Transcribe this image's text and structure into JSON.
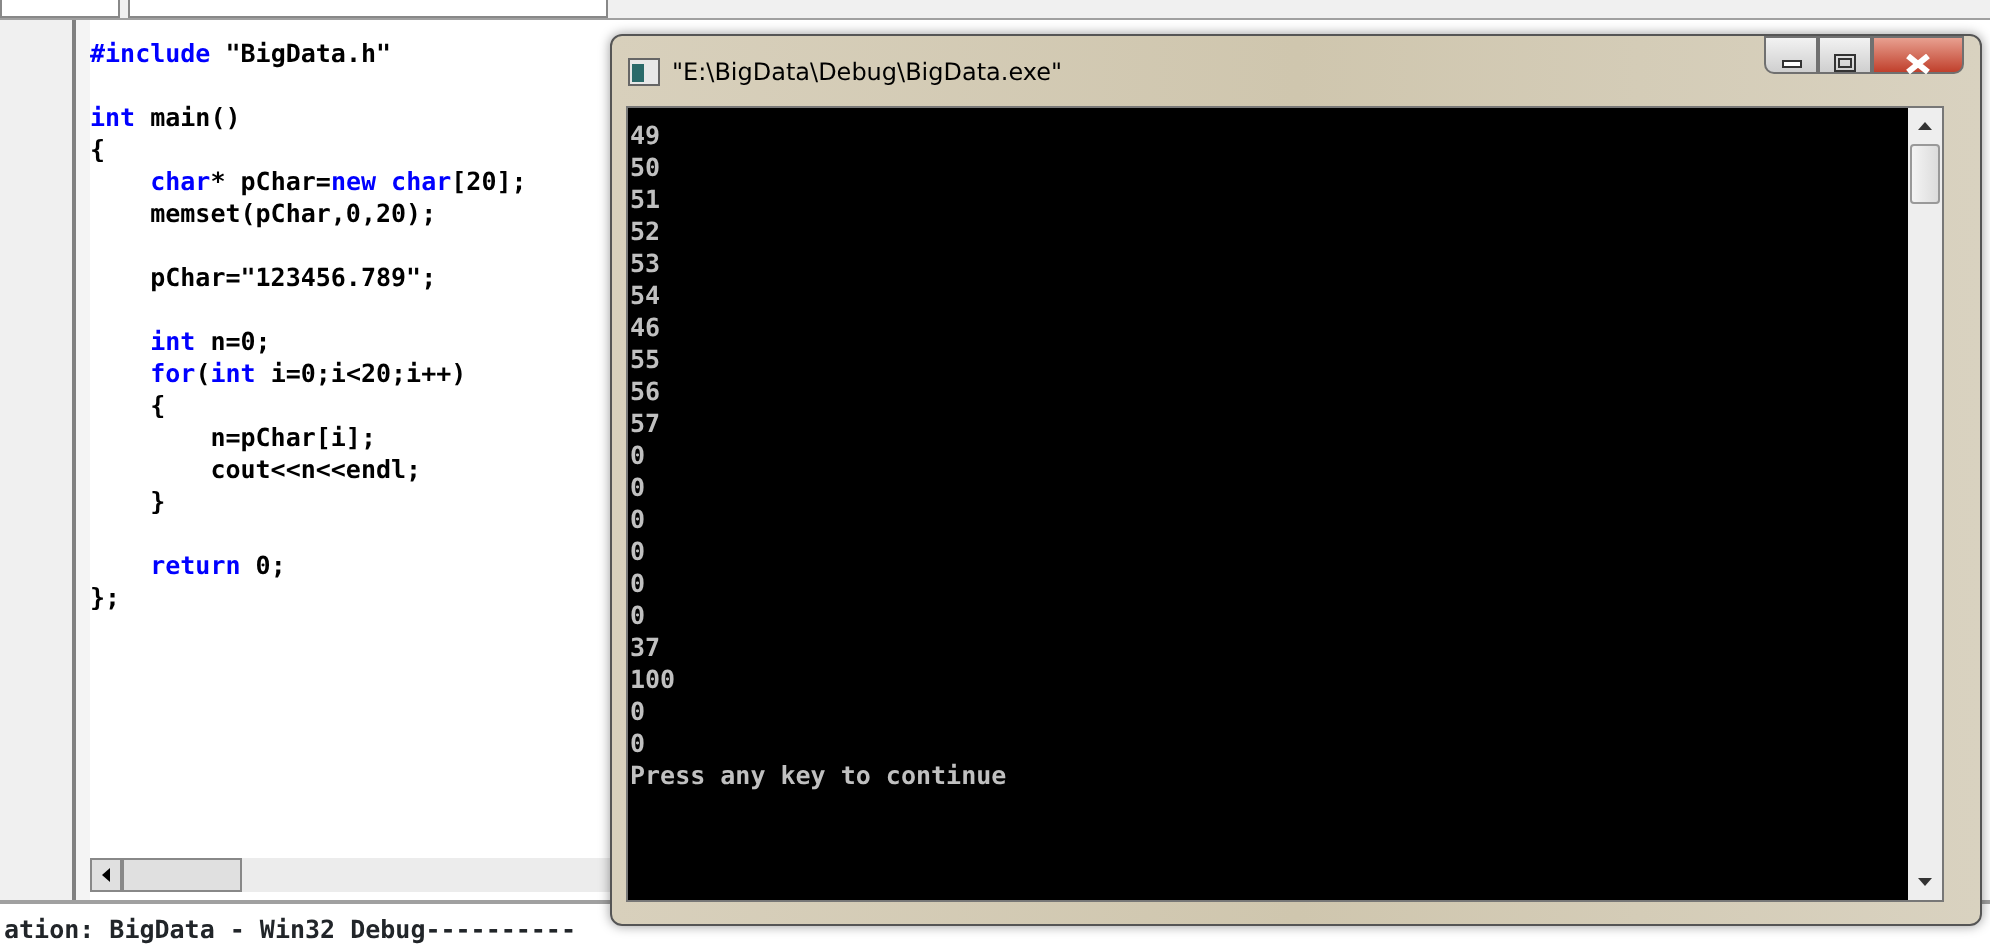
{
  "editor": {
    "lines": [
      {
        "kind": "code",
        "tokens": [
          {
            "text": "#include",
            "keyword": true
          },
          {
            "text": " \"BigData.h\"",
            "keyword": false
          }
        ]
      },
      {
        "kind": "blank"
      },
      {
        "kind": "code",
        "tokens": [
          {
            "text": "int",
            "keyword": true
          },
          {
            "text": " main()",
            "keyword": false
          }
        ]
      },
      {
        "kind": "code",
        "tokens": [
          {
            "text": "{",
            "keyword": false
          }
        ]
      },
      {
        "kind": "code",
        "tokens": [
          {
            "text": "    char",
            "keyword": true
          },
          {
            "text": "* pChar=",
            "keyword": false
          },
          {
            "text": "new",
            "keyword": true
          },
          {
            "text": " char",
            "keyword": true
          },
          {
            "text": "[20];",
            "keyword": false
          }
        ]
      },
      {
        "kind": "code",
        "tokens": [
          {
            "text": "    memset(pChar,0,20);",
            "keyword": false
          }
        ]
      },
      {
        "kind": "blank"
      },
      {
        "kind": "code",
        "tokens": [
          {
            "text": "    pChar=\"123456.789\";",
            "keyword": false
          }
        ]
      },
      {
        "kind": "blank"
      },
      {
        "kind": "code",
        "tokens": [
          {
            "text": "    int",
            "keyword": true
          },
          {
            "text": " n=0;",
            "keyword": false
          }
        ]
      },
      {
        "kind": "code",
        "tokens": [
          {
            "text": "    for",
            "keyword": true
          },
          {
            "text": "(",
            "keyword": false
          },
          {
            "text": "int",
            "keyword": true
          },
          {
            "text": " i=0;i<20;i++)",
            "keyword": false
          }
        ]
      },
      {
        "kind": "code",
        "tokens": [
          {
            "text": "    {",
            "keyword": false
          }
        ]
      },
      {
        "kind": "code",
        "tokens": [
          {
            "text": "        n=pChar[i];",
            "keyword": false
          }
        ]
      },
      {
        "kind": "code",
        "tokens": [
          {
            "text": "        cout<<n<<endl;",
            "keyword": false
          }
        ]
      },
      {
        "kind": "code",
        "tokens": [
          {
            "text": "    }",
            "keyword": false
          }
        ]
      },
      {
        "kind": "blank"
      },
      {
        "kind": "code",
        "tokens": [
          {
            "text": "    return",
            "keyword": true
          },
          {
            "text": " 0;",
            "keyword": false
          }
        ]
      },
      {
        "kind": "code",
        "tokens": [
          {
            "text": "};",
            "keyword": false
          }
        ]
      }
    ]
  },
  "output_bar": {
    "text": "ation: BigData - Win32 Debug----------"
  },
  "console": {
    "title": "\"E:\\BigData\\Debug\\BigData.exe\"",
    "lines": [
      "49",
      "50",
      "51",
      "52",
      "53",
      "54",
      "46",
      "55",
      "56",
      "57",
      "0",
      "0",
      "0",
      "0",
      "0",
      "0",
      "37",
      "100",
      "0",
      "0",
      "Press any key to continue"
    ]
  }
}
